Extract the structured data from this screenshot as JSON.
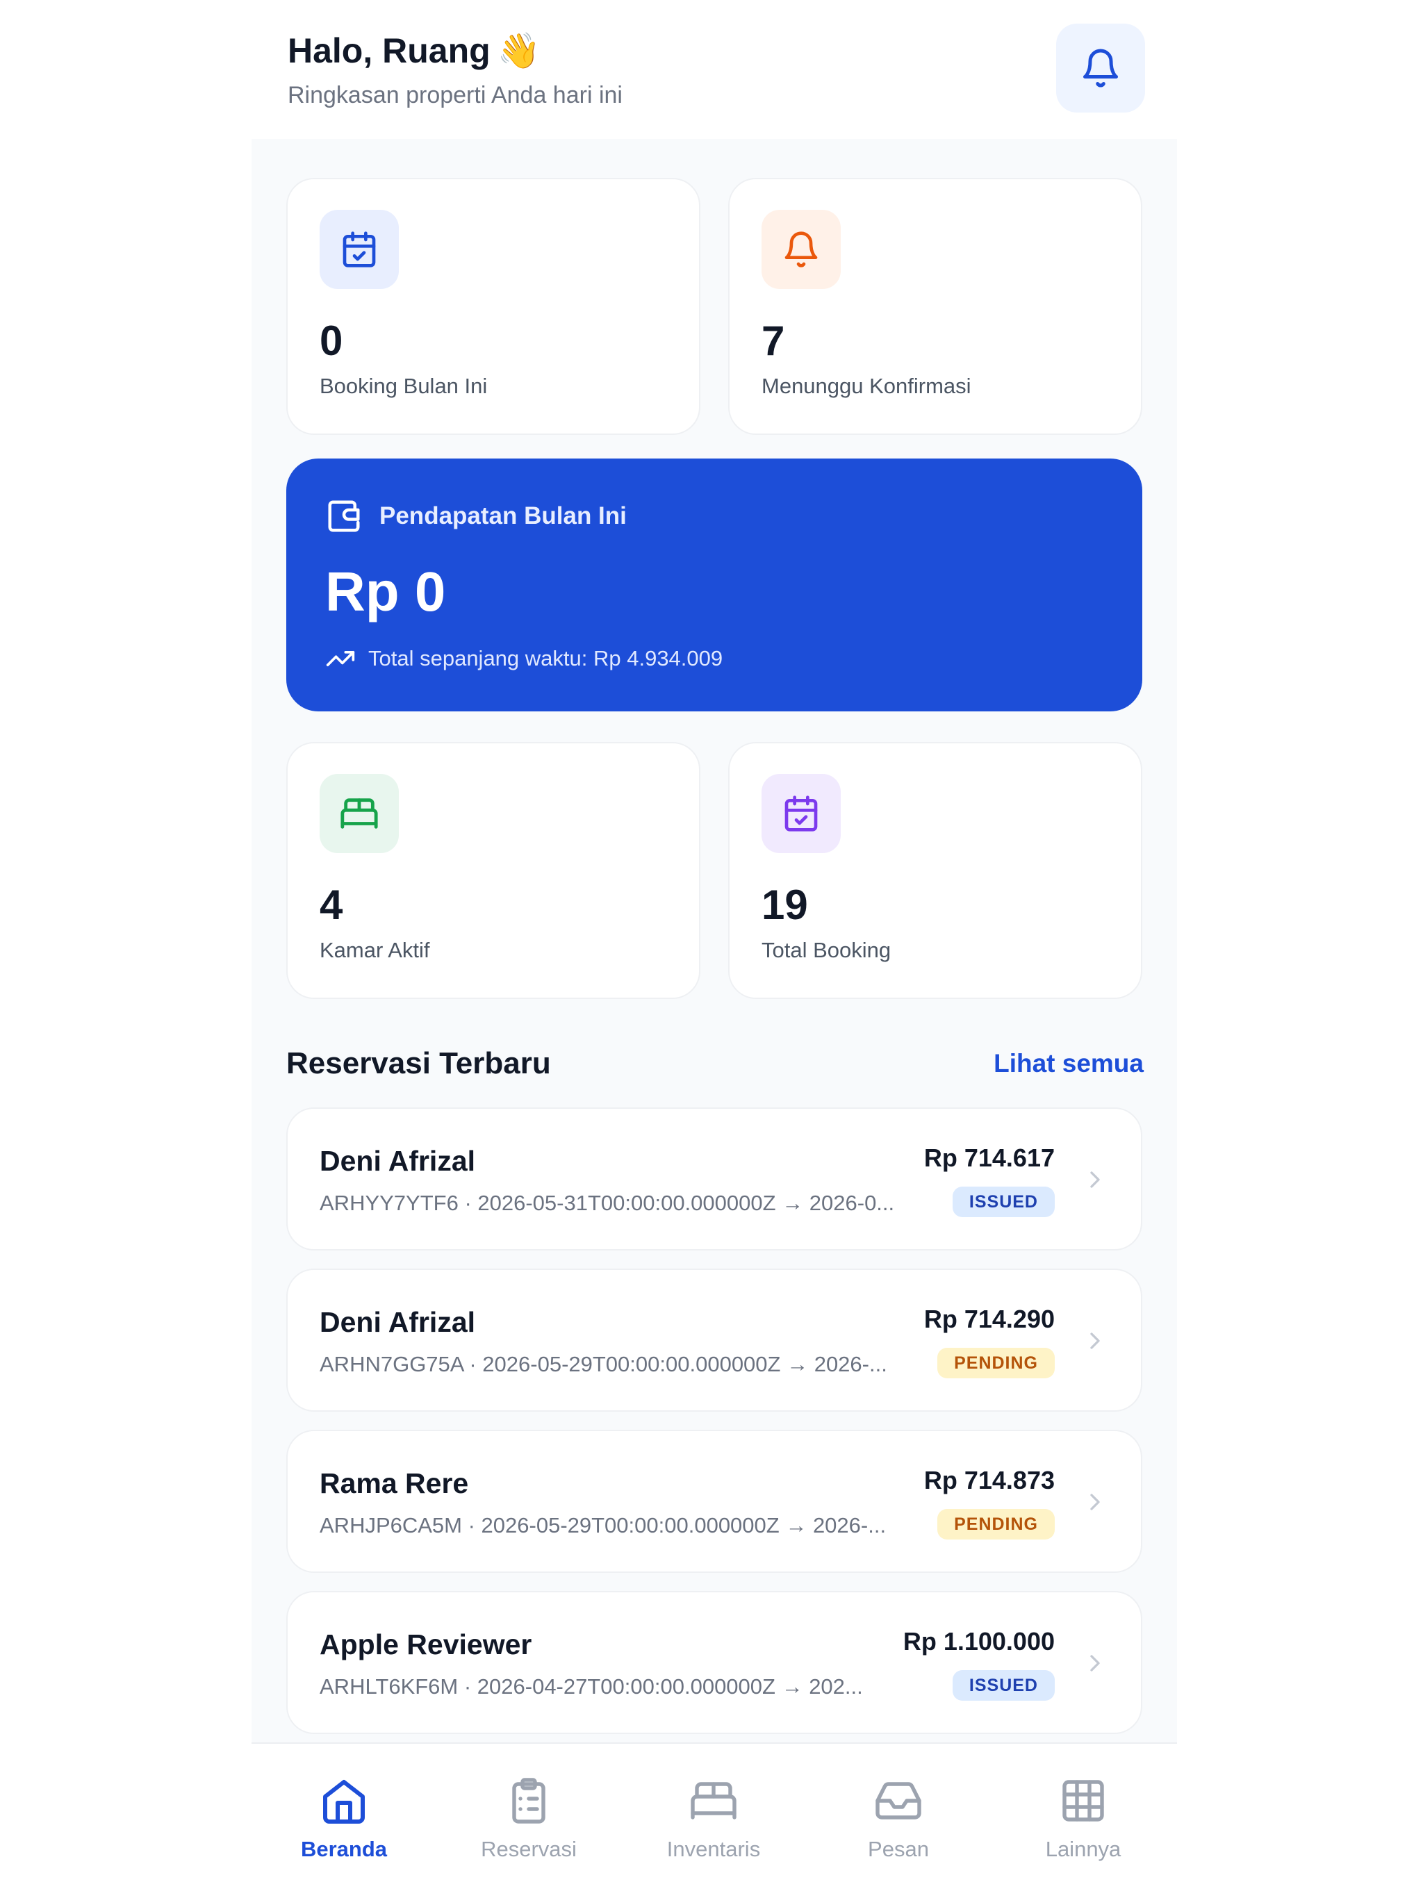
{
  "header": {
    "greeting": "Halo, Ruang",
    "wave_emoji": "👋",
    "subtitle": "Ringkasan properti Anda hari ini"
  },
  "stats": [
    {
      "value": "0",
      "label": "Booking Bulan Ini",
      "icon": "calendar-check-icon",
      "icon_bg": "#e8eefe",
      "icon_color": "#1d4ed8"
    },
    {
      "value": "7",
      "label": "Menunggu Konfirmasi",
      "icon": "bell-icon",
      "icon_bg": "#fff1e8",
      "icon_color": "#ea580c"
    },
    {
      "value": "4",
      "label": "Kamar Aktif",
      "icon": "bed-icon",
      "icon_bg": "#e8f6ee",
      "icon_color": "#16a34a"
    },
    {
      "value": "19",
      "label": "Total Booking",
      "icon": "calendar-check-icon",
      "icon_bg": "#f1eafe",
      "icon_color": "#7c3aed"
    }
  ],
  "revenue": {
    "title": "Pendapatan Bulan Ini",
    "amount": "Rp 0",
    "total": "Total sepanjang waktu: Rp 4.934.009",
    "color": "#1d4ed8"
  },
  "reservations": {
    "title": "Reservasi Terbaru",
    "see_all": "Lihat semua",
    "items": [
      {
        "name": "Deni Afrizal",
        "meta": "ARHYY7YTF6 · 2026-05-31T00:00:00.000000Z → 2026-0...",
        "price": "Rp 714.617",
        "status": "ISSUED"
      },
      {
        "name": "Deni Afrizal",
        "meta": "ARHN7GG75A · 2026-05-29T00:00:00.000000Z → 2026-...",
        "price": "Rp 714.290",
        "status": "PENDING"
      },
      {
        "name": "Rama Rere",
        "meta": "ARHJP6CA5M · 2026-05-29T00:00:00.000000Z → 2026-...",
        "price": "Rp 714.873",
        "status": "PENDING"
      },
      {
        "name": "Apple Reviewer",
        "meta": "ARHLT6KF6M · 2026-04-27T00:00:00.000000Z → 202...",
        "price": "Rp 1.100.000",
        "status": "ISSUED"
      }
    ]
  },
  "tabs": [
    {
      "label": "Beranda",
      "icon": "home-icon",
      "active": true
    },
    {
      "label": "Reservasi",
      "icon": "clipboard-list-icon",
      "active": false
    },
    {
      "label": "Inventaris",
      "icon": "bed-icon",
      "active": false
    },
    {
      "label": "Pesan",
      "icon": "inbox-icon",
      "active": false
    },
    {
      "label": "Lainnya",
      "icon": "grid-icon",
      "active": false
    }
  ],
  "colors": {
    "accent": "#1d4ed8",
    "issued_bg": "#dbeafe",
    "issued_text": "#1e40af",
    "pending_bg": "#fef3c7",
    "pending_text": "#b45309"
  }
}
